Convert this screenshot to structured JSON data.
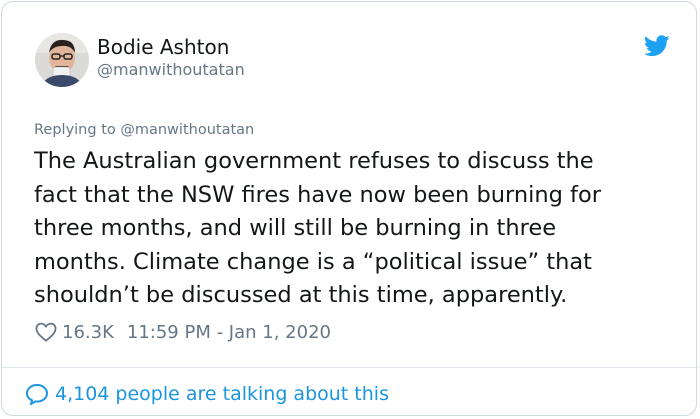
{
  "author": {
    "display_name": "Bodie Ashton",
    "handle": "@manwithoutatan",
    "avatar_icon": "avatar-photo"
  },
  "reply_to": "Replying to @manwithoutatan",
  "tweet": {
    "lines": [
      "The Australian government refuses to discuss the",
      "fact that the NSW fires have now been burning for",
      "three months, and will still be burning in three",
      "months. Climate change is a “political issue” that",
      "shouldn’t be discussed at this time, apparently."
    ]
  },
  "meta": {
    "likes": "16.3K",
    "timestamp": "11:59 PM - Jan 1, 2020"
  },
  "footer": {
    "talking": "4,104 people are talking about this"
  },
  "colors": {
    "twitter_blue": "#1da1f2",
    "link_blue": "#1b95e0",
    "text": "#14171a",
    "muted": "#657786",
    "border": "#cfd9de"
  },
  "icons": {
    "brand": "twitter-bird-icon",
    "like": "heart-icon",
    "reply": "speech-bubble-icon"
  }
}
